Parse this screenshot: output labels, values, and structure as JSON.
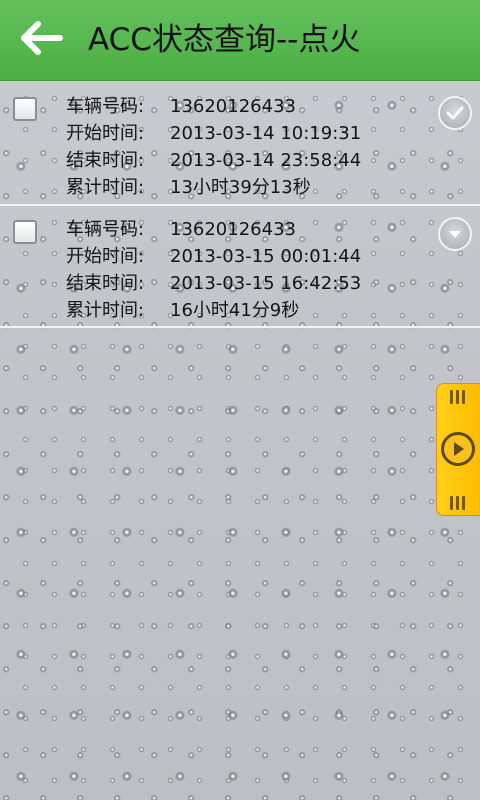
{
  "header": {
    "title": "ACC状态查询--点火",
    "back_icon": "arrow-left-icon"
  },
  "records": [
    {
      "labels": {
        "plate": "车辆号码:",
        "start": "开始时间:",
        "end": "结束时间:",
        "total": "累计时间:"
      },
      "plate": "13620126433",
      "start": "2013-03-14 10:19:31",
      "end": "2013-03-14 23:58:44",
      "total": "13小时39分13秒"
    },
    {
      "labels": {
        "plate": "车辆号码:",
        "start": "开始时间:",
        "end": "结束时间:",
        "total": "累计时间:"
      },
      "plate": "13620126433",
      "start": "2013-03-15 00:01:44",
      "end": "2013-03-15 16:42:53",
      "total": "16小时41分9秒"
    }
  ],
  "colors": {
    "header": "#4cae45",
    "side_tab": "#ffbf00"
  },
  "side_tab": {
    "icon": "play-icon"
  }
}
